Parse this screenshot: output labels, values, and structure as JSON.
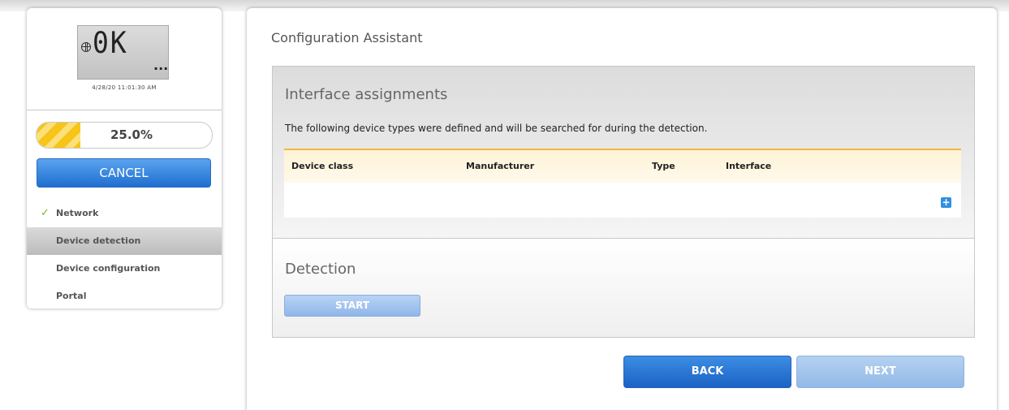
{
  "sidebar": {
    "display_text": "0K",
    "display_indicator": "...",
    "datetime": "4/28/20 11:01:30 AM",
    "progress": {
      "fraction": 0.25,
      "label": "25.0%"
    },
    "cancel_label": "CANCEL",
    "nav_items": [
      {
        "label": "Network",
        "status": "done",
        "icon": "check-icon"
      },
      {
        "label": "Device detection",
        "status": "active"
      },
      {
        "label": "Device configuration",
        "status": "pending"
      },
      {
        "label": "Portal",
        "status": "pending"
      }
    ],
    "check_glyph": "✓"
  },
  "main": {
    "title": "Configuration Assistant",
    "interface_section": {
      "heading": "Interface assignments",
      "description": "The following device types were defined and will be searched for during the detection.",
      "columns": [
        "Device class",
        "Manufacturer",
        "Type",
        "Interface"
      ],
      "rows": [],
      "add_icon_glyph": "+"
    },
    "detection_section": {
      "heading": "Detection",
      "start_label": "START"
    },
    "back_label": "BACK",
    "next_label": "NEXT"
  },
  "colors": {
    "accent_blue": "#1f6fd0",
    "disabled_blue": "#a6c6ee",
    "progress_yellow": "#f7c419",
    "check_green": "#7cb518",
    "table_header_border": "#f3b73e"
  }
}
